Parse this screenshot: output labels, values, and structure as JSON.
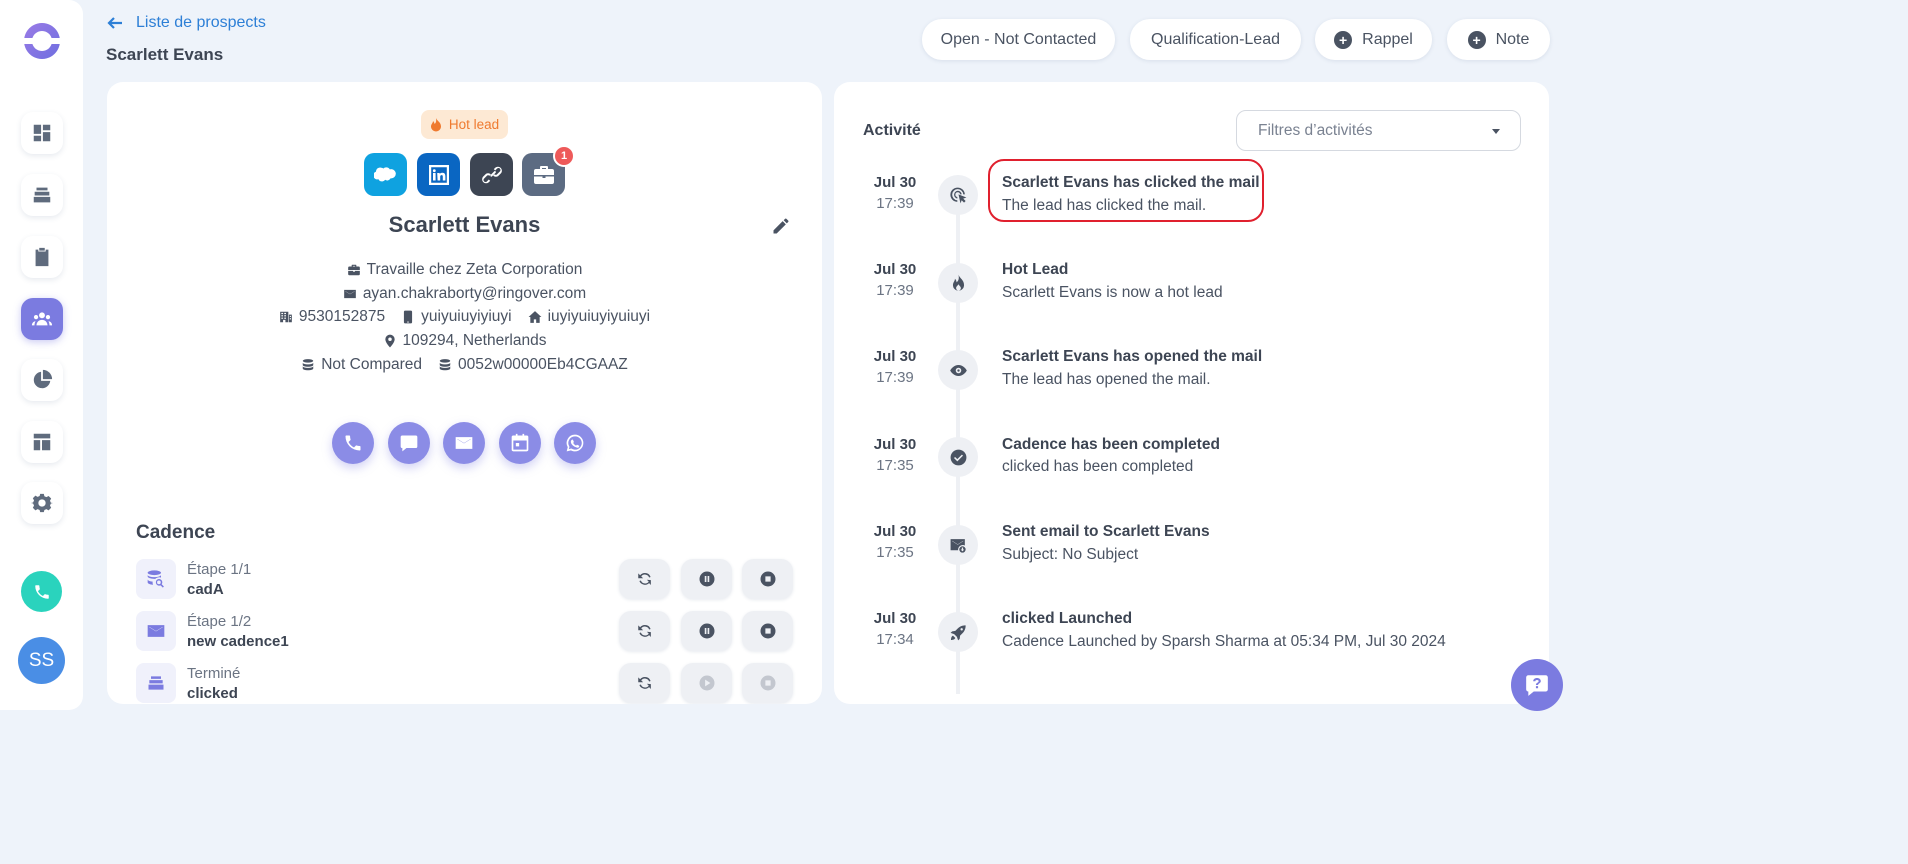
{
  "header": {
    "back_label": "Liste de prospects",
    "page_title": "Scarlett Evans",
    "buttons": {
      "status": "Open - Not Contacted",
      "stage": "Qualification-Lead",
      "reminder": "Rappel",
      "note": "Note"
    }
  },
  "sidebar": {
    "avatar_initials": "SS",
    "items": [
      "dashboard-icon",
      "layers-icon",
      "clipboard-icon",
      "people-icon",
      "pie-chart-icon",
      "layout-icon",
      "gear-icon"
    ],
    "active_item": "people-icon"
  },
  "lead": {
    "badge": "Hot lead",
    "notification_count": "1",
    "name": "Scarlett Evans",
    "company": "Travaille chez Zeta Corporation",
    "email": "ayan.chakraborty@ringover.com",
    "phone_office": "9530152875",
    "phone_mobile": "yuiyuiuyiyiuyi",
    "phone_home": "iuyiyuiuyiyuiuyi",
    "location": "109294, Netherlands",
    "compare_status": "Not Compared",
    "crm_id": "0052w00000Eb4CGAAZ"
  },
  "cadence": {
    "title": "Cadence",
    "steps": [
      {
        "label": "Étape 1/1",
        "name": "cadA",
        "state": "active"
      },
      {
        "label": "Étape 1/2",
        "name": "new cadence1",
        "state": "active"
      },
      {
        "label": "Terminé",
        "name": "clicked",
        "state": "completed"
      }
    ]
  },
  "activity": {
    "title": "Activité",
    "filter_placeholder": "Filtres d’activités",
    "events": [
      {
        "date": "Jul 30",
        "time": "17:39",
        "icon": "cursor-click-icon",
        "title": "Scarlett Evans has clicked the mail",
        "subtitle": "The lead has clicked the mail."
      },
      {
        "date": "Jul 30",
        "time": "17:39",
        "icon": "flame-icon",
        "title": "Hot Lead",
        "subtitle": "Scarlett Evans is now a hot lead"
      },
      {
        "date": "Jul 30",
        "time": "17:39",
        "icon": "eye-icon",
        "title": "Scarlett Evans has opened the mail",
        "subtitle": "The lead has opened the mail."
      },
      {
        "date": "Jul 30",
        "time": "17:35",
        "icon": "check-circle-icon",
        "title": "Cadence has been completed",
        "subtitle": "clicked has been completed"
      },
      {
        "date": "Jul 30",
        "time": "17:35",
        "icon": "mail-sent-icon",
        "title": "Sent email to Scarlett Evans",
        "subtitle": "Subject: No Subject"
      },
      {
        "date": "Jul 30",
        "time": "17:34",
        "icon": "rocket-icon",
        "title": "clicked Launched",
        "subtitle": "Cadence Launched by Sparsh Sharma at 05:34 PM, Jul 30 2024"
      }
    ]
  },
  "colors": {
    "accent": "#7b7be0",
    "link": "#2d7fd6",
    "hot": "#ef7a2f",
    "highlight": "#e0202e",
    "salesforce": "#0fa2e0",
    "linkedin": "#0a66c2"
  }
}
